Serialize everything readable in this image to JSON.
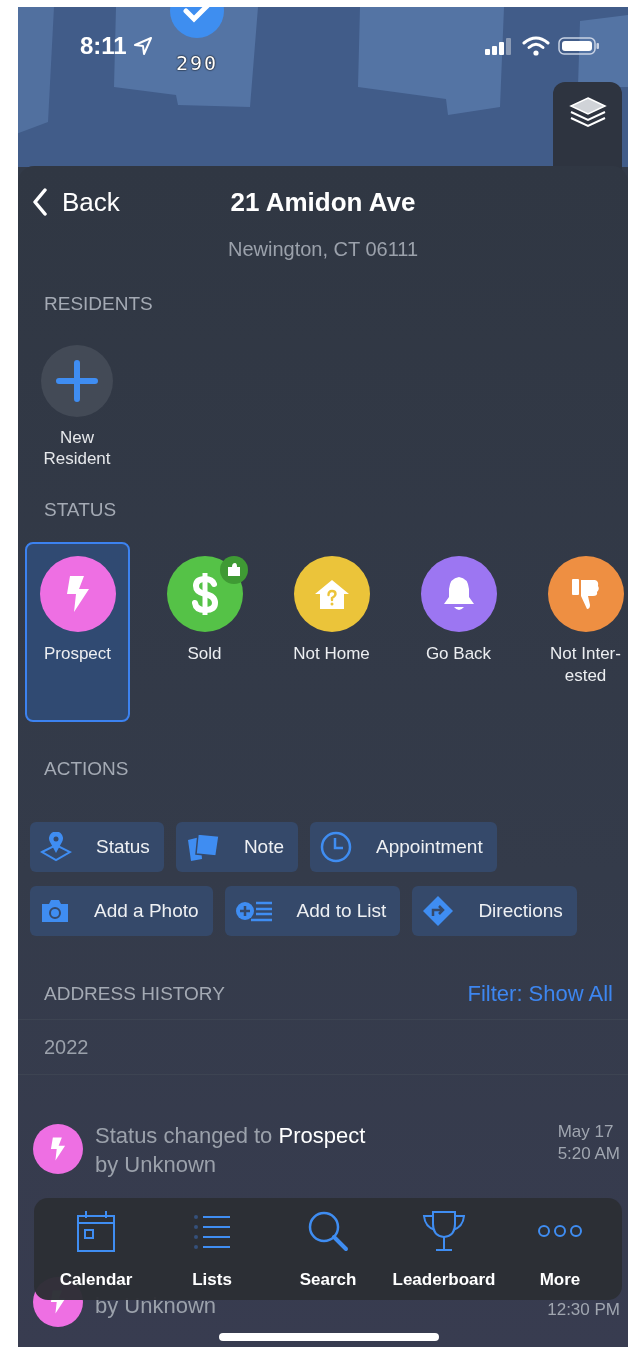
{
  "status_bar": {
    "time": "8:11"
  },
  "map": {
    "pin_label": "290"
  },
  "header": {
    "back": "Back",
    "title": "21 Amidon Ave",
    "subtitle": "Newington, CT 06111"
  },
  "residents": {
    "label": "RESIDENTS",
    "add_label": "New Resident"
  },
  "status_section": {
    "label": "STATUS"
  },
  "statuses": [
    {
      "name": "Prospect",
      "kind": "bolt",
      "color": "#ee6fe3",
      "selected": true,
      "addon": false
    },
    {
      "name": "Sold",
      "kind": "dollar",
      "color": "#55c247",
      "selected": false,
      "addon": true
    },
    {
      "name": "Not Home",
      "kind": "house",
      "color": "#ebc43a",
      "selected": false,
      "addon": false
    },
    {
      "name": "Go Back",
      "kind": "bell",
      "color": "#9c76f2",
      "selected": false,
      "addon": false
    },
    {
      "name": "Not Inter-ested",
      "kind": "thumbdown",
      "color": "#ee8f42",
      "selected": false,
      "addon": false
    }
  ],
  "actions_section": {
    "label": "ACTIONS"
  },
  "action_rows": [
    {
      "buttons": [
        {
          "label": "Status",
          "kind": "pin"
        },
        {
          "label": "Note",
          "kind": "note"
        },
        {
          "label": "Appointment",
          "kind": "clock"
        }
      ]
    },
    {
      "buttons": [
        {
          "label": "Add a Photo",
          "kind": "camera"
        },
        {
          "label": "Add to List",
          "kind": "addlist"
        },
        {
          "label": "Directions",
          "kind": "directions"
        }
      ]
    }
  ],
  "history": {
    "label": "ADDRESS HISTORY",
    "filter": "Filter: Show All",
    "year": "2022",
    "items": [
      {
        "color": "#ee6fe3",
        "text": "Status changed to",
        "status": "Prospect",
        "by": "by Unknown",
        "date": "May 17",
        "time": "5:20 AM"
      },
      {
        "color": "#ee6fe3",
        "by": "by Unknown",
        "time": "12:30 PM"
      }
    ]
  },
  "tab_bar": [
    {
      "label": "Calendar",
      "kind": "calendar"
    },
    {
      "label": "Lists",
      "kind": "list"
    },
    {
      "label": "Search",
      "kind": "search"
    },
    {
      "label": "Leaderboard",
      "kind": "trophy"
    },
    {
      "label": "More",
      "kind": "more"
    }
  ]
}
